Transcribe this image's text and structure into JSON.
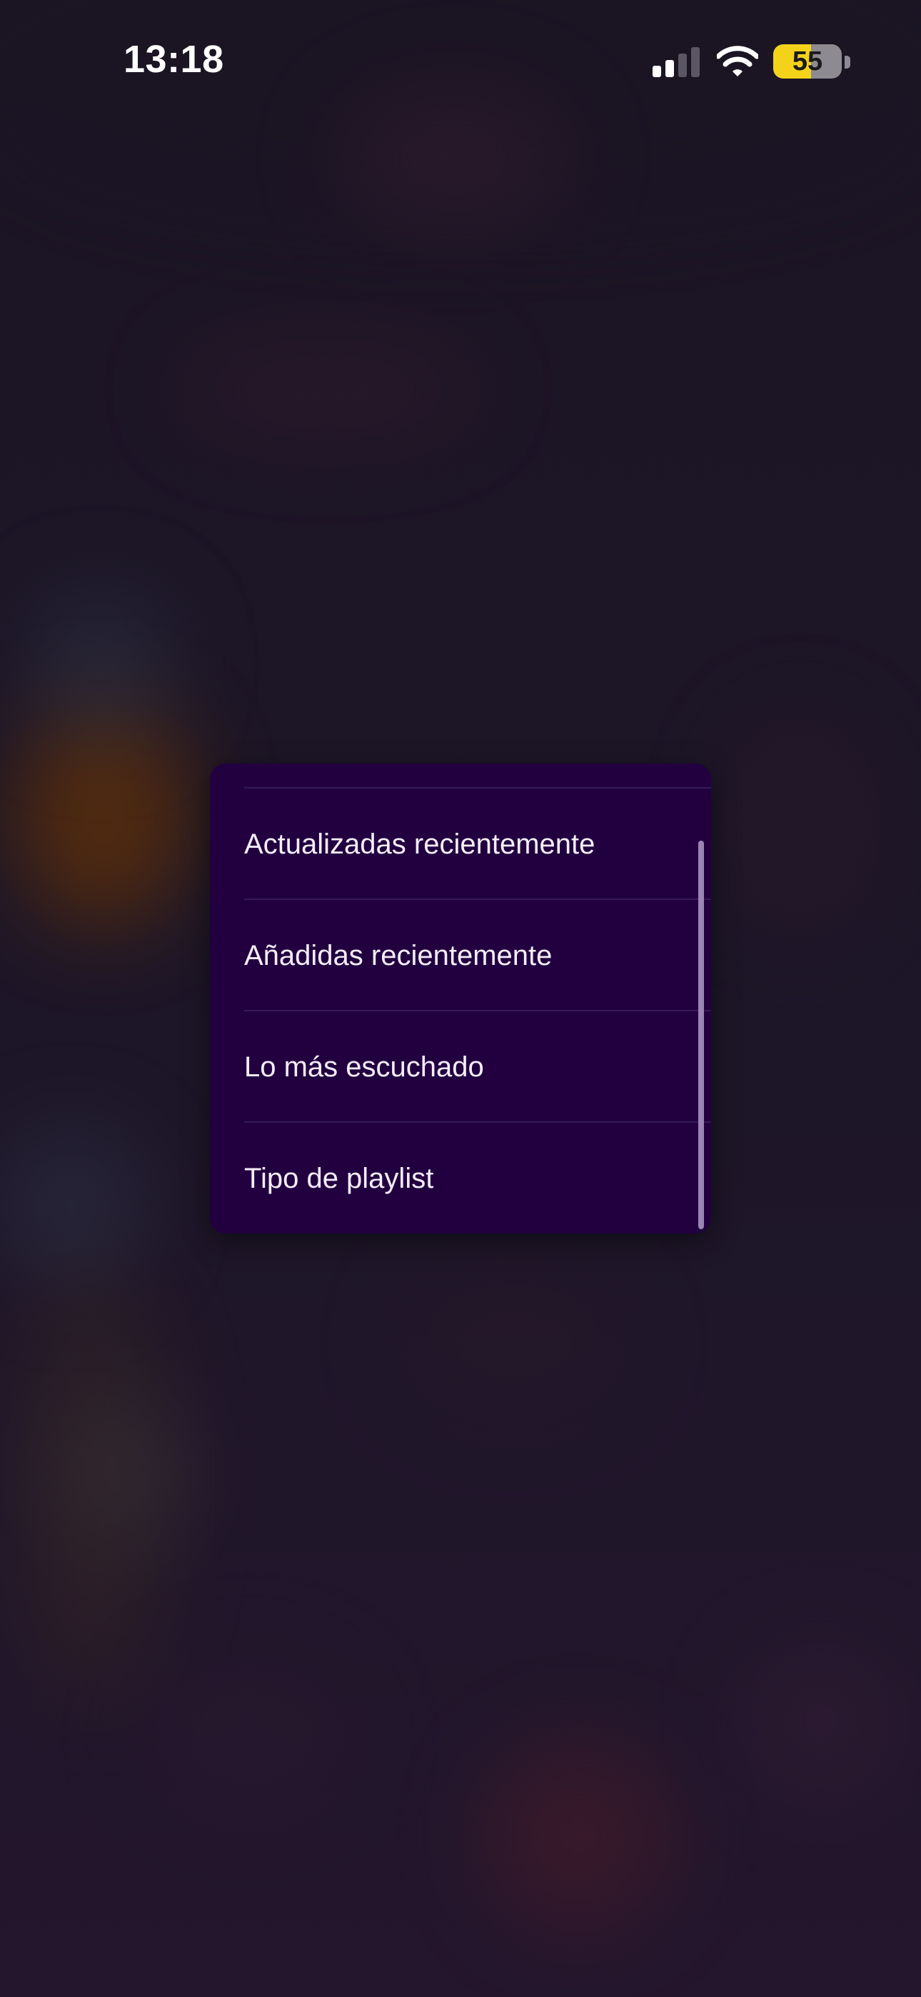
{
  "status_bar": {
    "time": "13:18",
    "signal_icon": "cellular-signal-icon",
    "signal_bars_active": 2,
    "signal_bars_total": 4,
    "wifi_icon": "wifi-icon",
    "battery_icon": "battery-icon",
    "battery_level": "55",
    "battery_fraction": 0.55,
    "battery_color": "#f4d21a"
  },
  "sort_menu": {
    "items": [
      {
        "label": "Actualizadas recientemente"
      },
      {
        "label": "Añadidas recientemente"
      },
      {
        "label": "Lo más escuchado"
      },
      {
        "label": "Tipo de playlist"
      }
    ],
    "background_color": "#220040"
  }
}
